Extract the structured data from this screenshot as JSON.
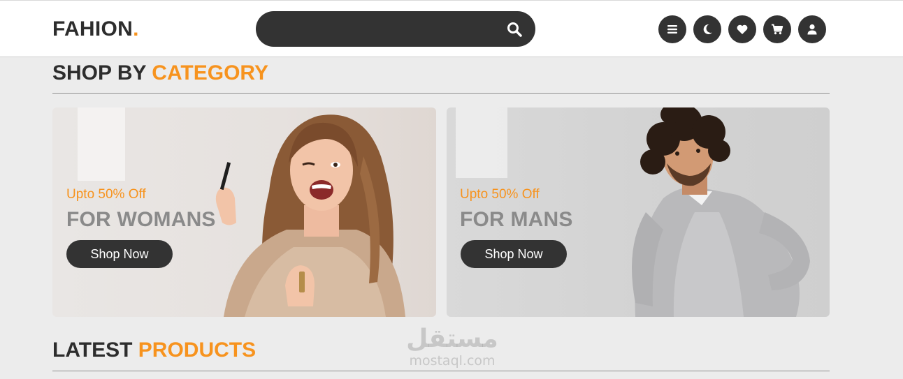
{
  "header": {
    "logo_text": "FAHION",
    "logo_dot": ".",
    "search_placeholder": "",
    "icons": [
      "menu-icon",
      "moon-icon",
      "heart-icon",
      "cart-icon",
      "user-icon"
    ]
  },
  "category_section": {
    "title_main": "SHOP BY",
    "title_accent": "CATEGORY"
  },
  "cards": [
    {
      "offer": "Upto 50% Off",
      "heading": "FOR WOMANS",
      "button": "Shop Now"
    },
    {
      "offer": "Upto 50% Off",
      "heading": "FOR MANS",
      "button": "Shop Now"
    }
  ],
  "products_section": {
    "title_main": "LATEST",
    "title_accent": "PRODUCTS"
  },
  "watermark": {
    "arabic": "مستقل",
    "latin": "mostaql.com"
  },
  "colors": {
    "accent": "#f7931e",
    "dark": "#333333",
    "background": "#ececec"
  }
}
